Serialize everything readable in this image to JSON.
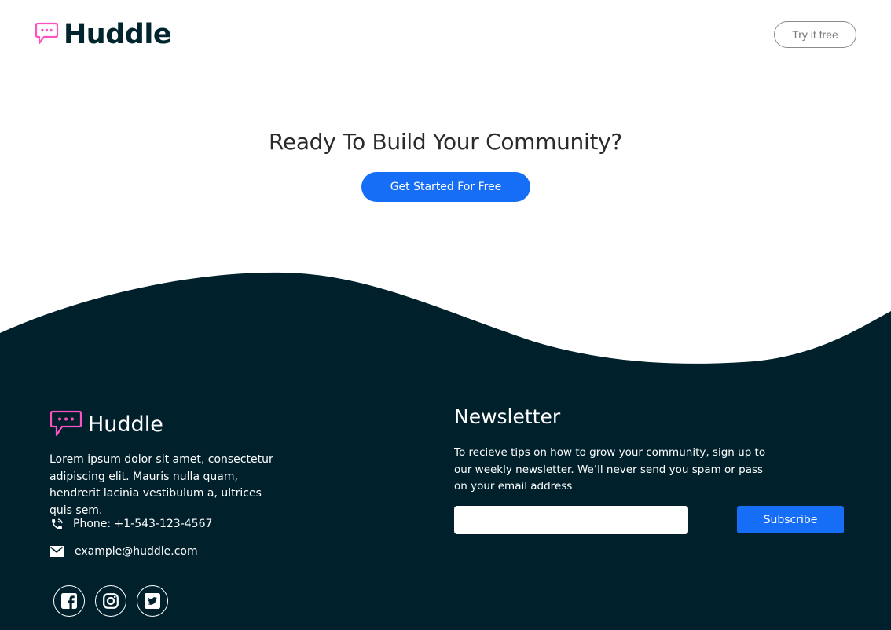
{
  "header": {
    "logo_text": "Huddle",
    "cta_label": "Try it free"
  },
  "hero": {
    "title": "Ready To Build Your Community?",
    "button_label": "Get Started For Free"
  },
  "footer": {
    "logo_text": "Huddle",
    "description": "Lorem ipsum dolor sit amet, consectetur adipiscing elit. Mauris nulla quam, hendrerit lacinia vestibulum a, ultrices quis sem.",
    "phone": "Phone: +1-543-123-4567",
    "email": "example@huddle.com",
    "socials": [
      "facebook-icon",
      "instagram-icon",
      "twitter-icon"
    ]
  },
  "newsletter": {
    "title": "Newsletter",
    "description": "To recieve tips on how to grow your community, sign up to our weekly newsletter. We’ll never send you spam or pass on your email address",
    "input_value": "",
    "button_label": "Subscribe"
  },
  "colors": {
    "accent": "#166ef6",
    "dark": "#00212c",
    "logo_pink": "#ff52c1"
  }
}
